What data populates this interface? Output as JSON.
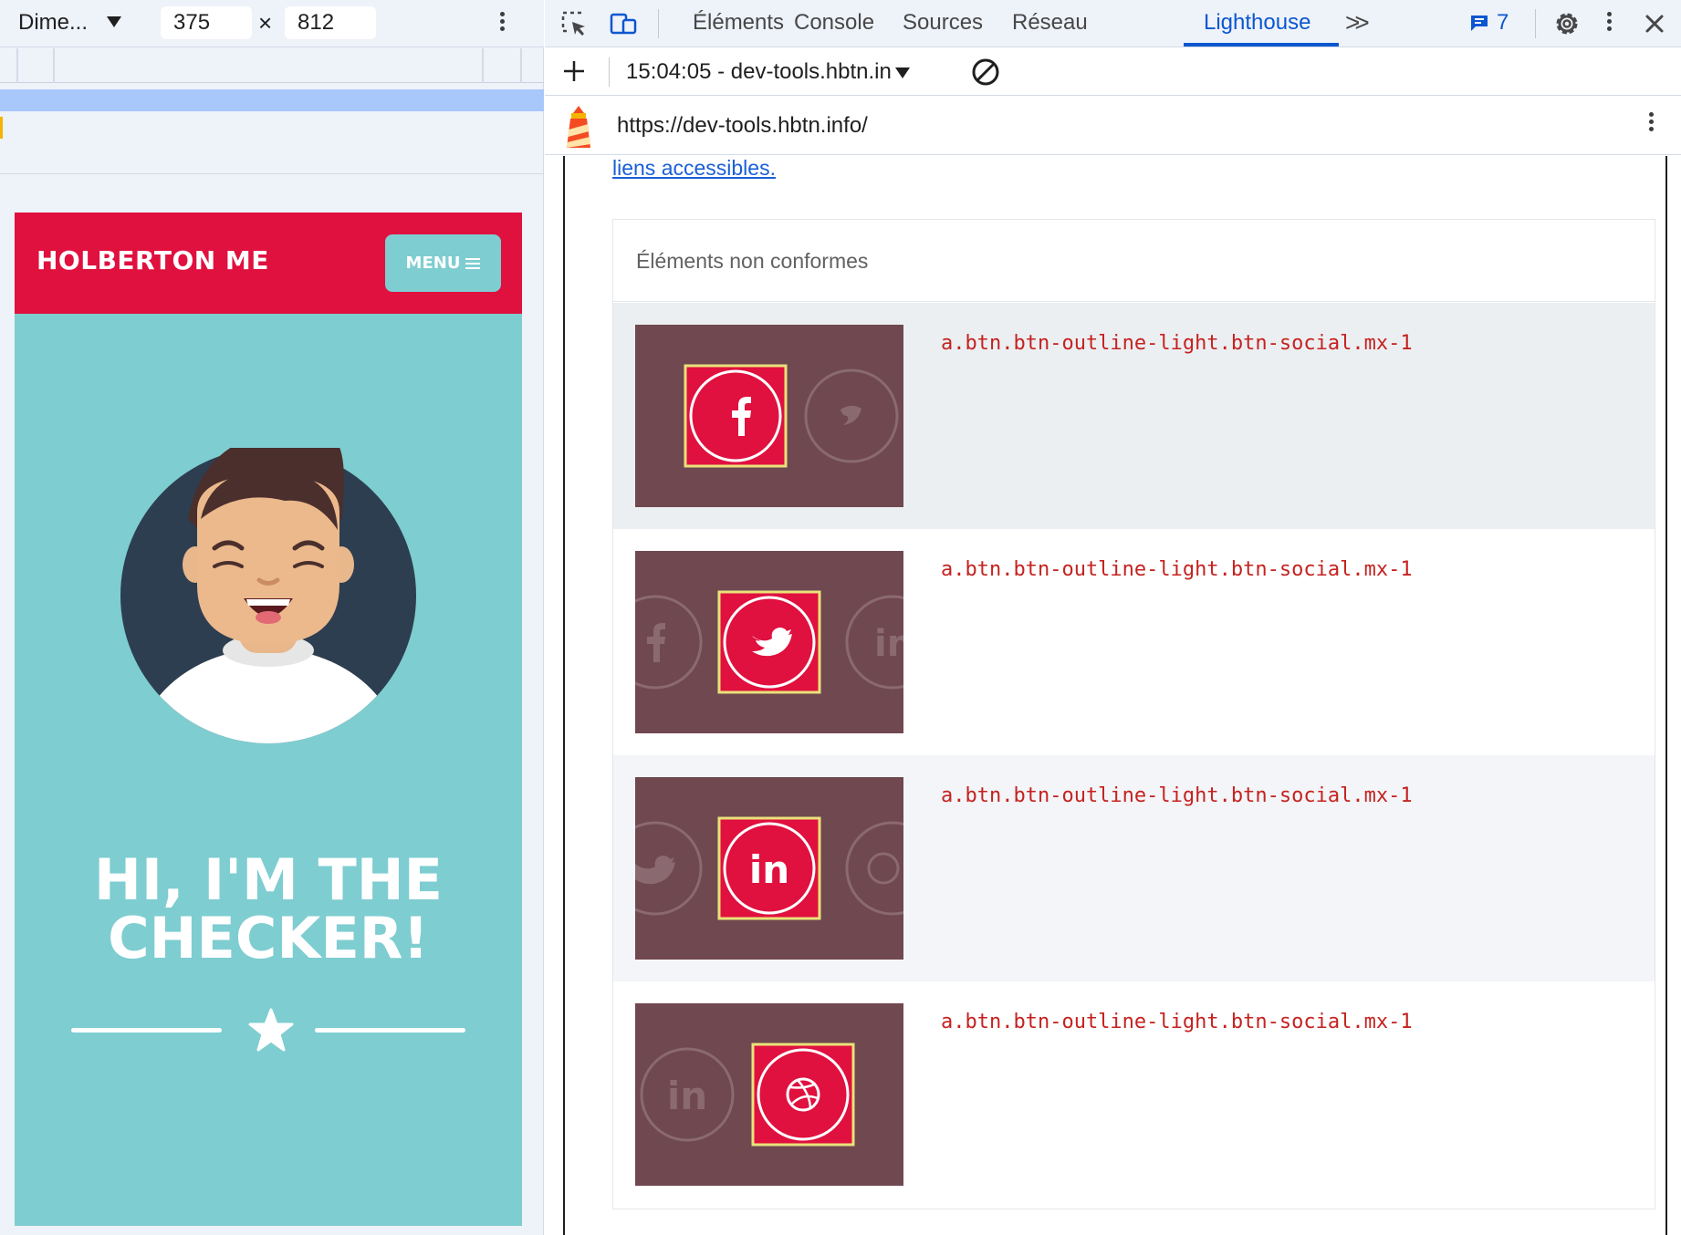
{
  "device_toolbar": {
    "device": "Dime...",
    "width": "375",
    "times": "×",
    "height": "812"
  },
  "site": {
    "brand": "HOLBERTON ME",
    "menu_label": "MENU",
    "hero_line1": "HI, I'M THE",
    "hero_line2": "CHECKER!"
  },
  "devtools": {
    "tabs": [
      "Éléments",
      "Console",
      "Sources",
      "Réseau",
      "Lighthouse"
    ],
    "active_tab": "Lighthouse",
    "issues_count": "7",
    "report_select": "15:04:05 - dev-tools.hbtn.in",
    "url": "https://dev-tools.hbtn.info/"
  },
  "report": {
    "link_text": "liens accessibles.",
    "table_header": "Éléments non conformes",
    "rows": [
      {
        "selector": "a.btn.btn-outline-light.btn-social.mx-1",
        "icon": "facebook-icon"
      },
      {
        "selector": "a.btn.btn-outline-light.btn-social.mx-1",
        "icon": "twitter-icon"
      },
      {
        "selector": "a.btn.btn-outline-light.btn-social.mx-1",
        "icon": "linkedin-icon"
      },
      {
        "selector": "a.btn.btn-outline-light.btn-social.mx-1",
        "icon": "dribbble-icon"
      }
    ]
  },
  "colors": {
    "site_red": "#e0103f",
    "site_teal": "#7ecdd1",
    "accent_blue": "#0b57d0",
    "selector_red": "#c5221f",
    "snapshot_bg": "#704850",
    "highlight_yellow": "#e9e27a"
  }
}
